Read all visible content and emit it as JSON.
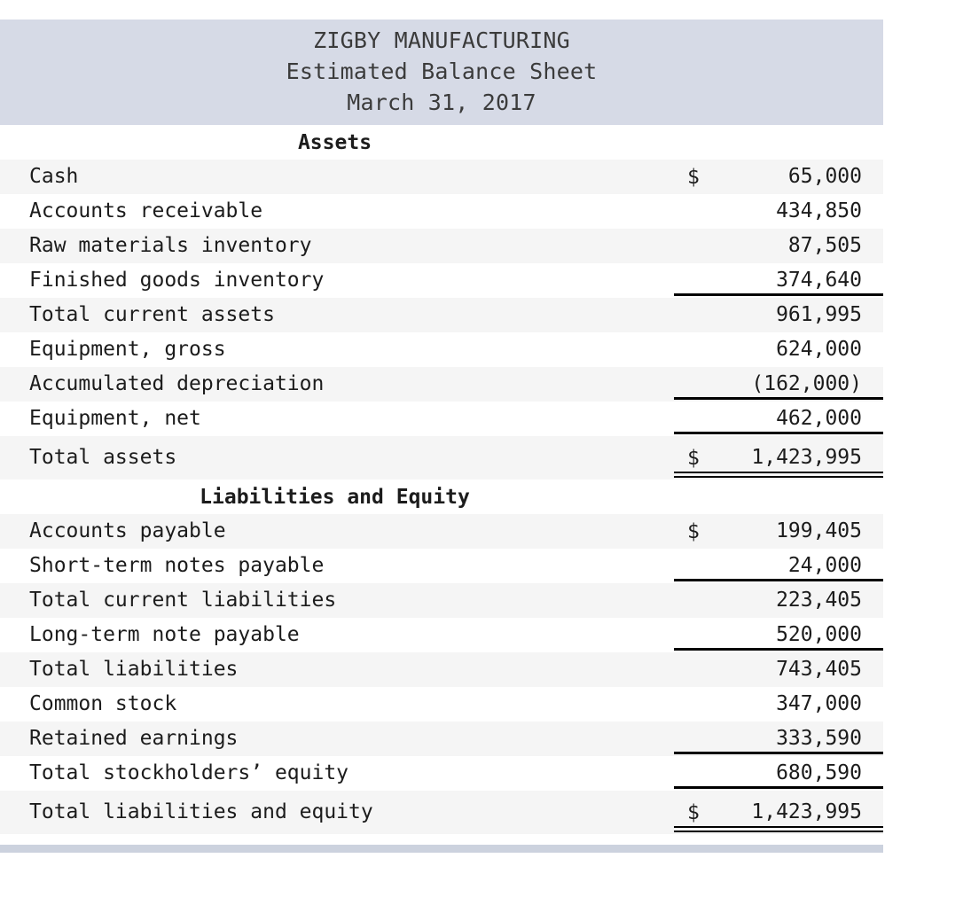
{
  "document": {
    "company": "ZIGBY MANUFACTURING",
    "statement_title": "Estimated Balance Sheet",
    "date": "March 31, 2017"
  },
  "sections": {
    "assets_heading": "Assets",
    "liabilities_heading": "Liabilities and Equity"
  },
  "currency_symbol": "$",
  "rows": [
    {
      "label": "Cash",
      "currency": "$",
      "amount": "65,000"
    },
    {
      "label": "Accounts receivable",
      "currency": "",
      "amount": "434,850"
    },
    {
      "label": "Raw materials inventory",
      "currency": "",
      "amount": "87,505"
    },
    {
      "label": "Finished goods inventory",
      "currency": "",
      "amount": "374,640"
    },
    {
      "label": "Total current assets",
      "currency": "",
      "amount": "961,995"
    },
    {
      "label": "Equipment, gross",
      "currency": "",
      "amount": "624,000"
    },
    {
      "label": "Accumulated depreciation",
      "currency": "",
      "amount": "(162,000)"
    },
    {
      "label": "Equipment, net",
      "currency": "",
      "amount": "462,000"
    },
    {
      "label": "Total assets",
      "currency": "$",
      "amount": "1,423,995"
    },
    {
      "label": "Accounts payable",
      "currency": "$",
      "amount": "199,405"
    },
    {
      "label": "Short-term notes payable",
      "currency": "",
      "amount": "24,000"
    },
    {
      "label": "Total current liabilities",
      "currency": "",
      "amount": "223,405"
    },
    {
      "label": "Long-term note payable",
      "currency": "",
      "amount": "520,000"
    },
    {
      "label": "Total liabilities",
      "currency": "",
      "amount": "743,405"
    },
    {
      "label": "Common stock",
      "currency": "",
      "amount": "347,000"
    },
    {
      "label": "Retained earnings",
      "currency": "",
      "amount": "333,590"
    },
    {
      "label": "Total stockholders’ equity",
      "currency": "",
      "amount": "680,590"
    },
    {
      "label": "Total liabilities and equity",
      "currency": "$",
      "amount": "1,423,995"
    }
  ],
  "colors": {
    "header_band": "#d6dae6",
    "footer_bar": "#ccd2de",
    "row_stripe": "#f5f5f5",
    "text": "#1c1c1c",
    "rule": "#000000"
  }
}
